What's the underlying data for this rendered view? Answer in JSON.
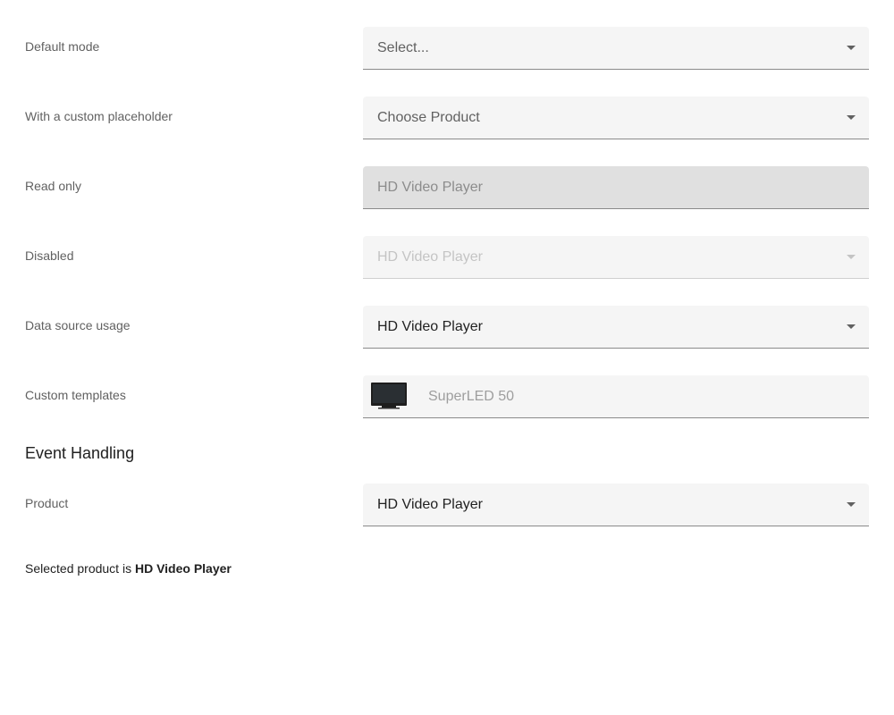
{
  "rows": [
    {
      "label": "Default mode",
      "text": "Select..."
    },
    {
      "label": "With a custom placeholder",
      "text": "Choose Product"
    },
    {
      "label": "Read only",
      "text": "HD Video Player"
    },
    {
      "label": "Disabled",
      "text": "HD Video Player"
    },
    {
      "label": "Data source usage",
      "text": "HD Video Player"
    },
    {
      "label": "Custom templates",
      "text": "SuperLED 50",
      "icon": "tv-icon"
    }
  ],
  "event_handling": {
    "title": "Event Handling",
    "product_label": "Product",
    "product_value": "HD Video Player",
    "selected_prefix": "Selected product is",
    "selected_value": "HD Video Player"
  },
  "colors": {
    "field_bg": "#f5f5f5",
    "readonly_bg": "#e0e0e0",
    "label": "#616161",
    "text": "#212121"
  }
}
